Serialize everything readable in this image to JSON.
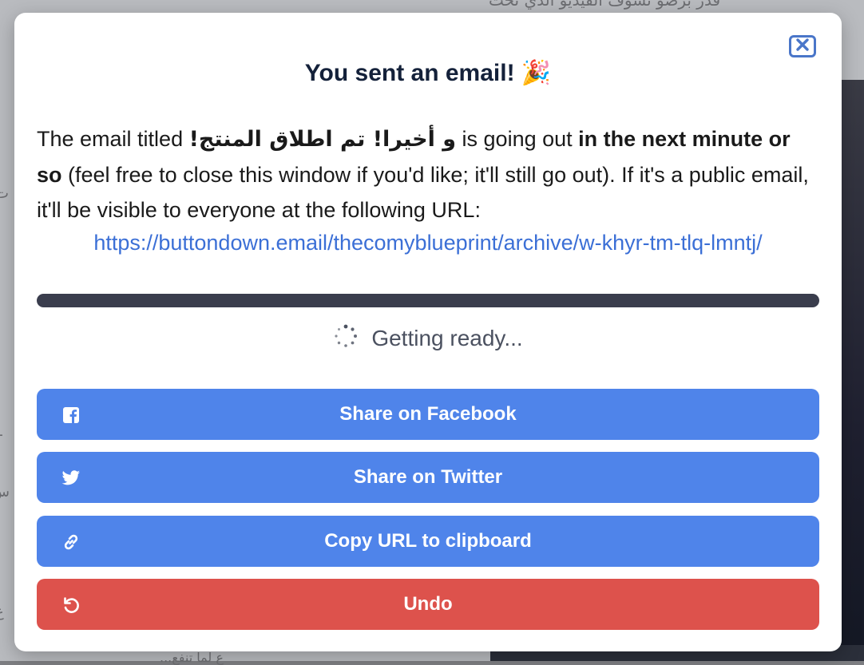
{
  "background": {
    "top_text": "قدر برضو تشوف الفيديو الذي تحت",
    "left_text_1": "ت",
    "left_text_2": "ـا",
    "left_text_3": "س",
    "left_text_4": "ع",
    "bottom_text": "ع لما تنفع..."
  },
  "modal": {
    "title": "You sent an email! 🎉",
    "body": {
      "prefix": "The email titled ",
      "email_title": "و أخيرا! تم اطلاق المنتج!",
      "middle": " is going out ",
      "emphasis": "in the next minute or so",
      "suffix": " (feel free to close this window if you'd like; it'll still go out). If it's a public email, it'll be visible to everyone at the following URL:"
    },
    "url": "https://buttondown.email/thecomyblueprint/archive/w-khyr-tm-tlq-lmntj/",
    "status_text": "Getting ready...",
    "buttons": {
      "facebook": "Share on Facebook",
      "twitter": "Share on Twitter",
      "copy": "Copy URL to clipboard",
      "undo": "Undo"
    }
  },
  "colors": {
    "primary_blue": "#4f84ea",
    "danger_red": "#dd524c",
    "link_blue": "#3b6fd6",
    "progress_dark": "#3a3d4d",
    "close_border": "#4a76c9"
  },
  "icons": {
    "close": "close-icon",
    "facebook": "facebook-icon",
    "twitter": "twitter-icon",
    "link": "link-icon",
    "undo": "undo-icon",
    "spinner": "spinner-icon"
  }
}
